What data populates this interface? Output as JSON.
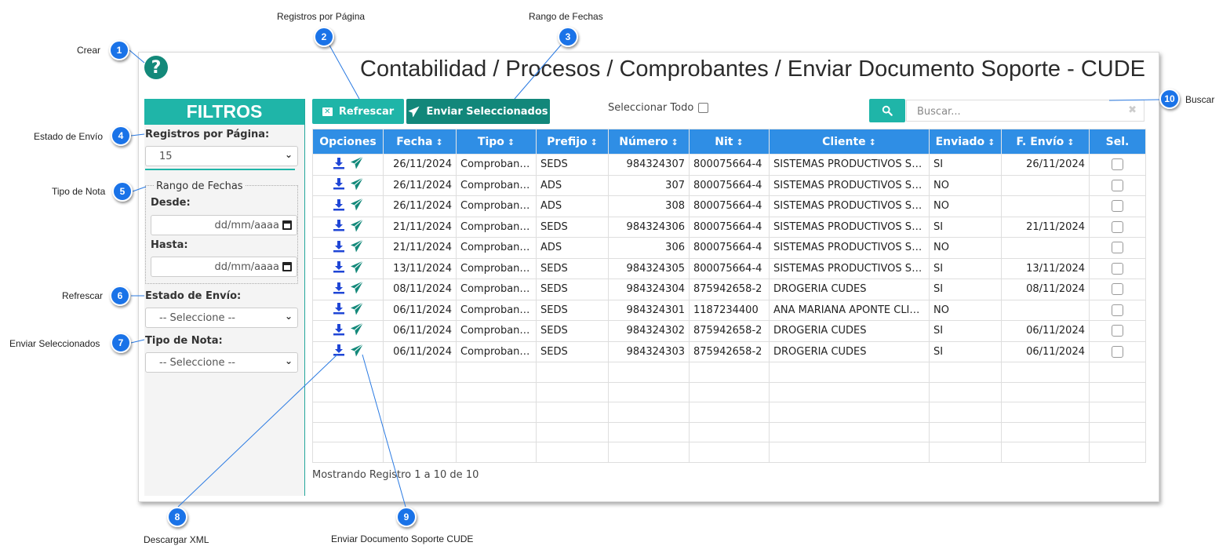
{
  "page": {
    "title": "Contabilidad / Procesos / Comprobantes / Enviar Documento Soporte - CUDE",
    "help_glyph": "?"
  },
  "sidebar": {
    "header": "FILTROS",
    "registros_label": "Registros por Página:",
    "registros_value": "15",
    "date_range_legend": "Rango de Fechas",
    "desde_label": "Desde:",
    "desde_placeholder": "dd/mm/aaaa",
    "hasta_label": "Hasta:",
    "hasta_placeholder": "dd/mm/aaaa",
    "estado_label": "Estado de Envío:",
    "estado_value": "-- Seleccione --",
    "tipo_label": "Tipo de Nota:",
    "tipo_value": "-- Seleccione --"
  },
  "toolbar": {
    "refresh_label": "Refrescar",
    "send_label": "Enviar Seleccionados",
    "select_all_label": "Seleccionar Todo",
    "search_placeholder": "Buscar..."
  },
  "table": {
    "columns": [
      "Opciones",
      "Fecha",
      "Tipo",
      "Prefijo",
      "Número",
      "Nit",
      "Cliente",
      "Enviado",
      "F. Envío",
      "Sel."
    ],
    "rows": [
      {
        "fecha": "26/11/2024",
        "tipo": "Comprobante...",
        "prefijo": "SEDS",
        "numero": "984324307",
        "nit": "800075664-4",
        "cliente": "SISTEMAS PRODUCTIVOS SAS",
        "enviado": "SI",
        "f_envio": "26/11/2024"
      },
      {
        "fecha": "26/11/2024",
        "tipo": "Comprobante...",
        "prefijo": "ADS",
        "numero": "307",
        "nit": "800075664-4",
        "cliente": "SISTEMAS PRODUCTIVOS SAS",
        "enviado": "NO",
        "f_envio": ""
      },
      {
        "fecha": "26/11/2024",
        "tipo": "Comprobante...",
        "prefijo": "ADS",
        "numero": "308",
        "nit": "800075664-4",
        "cliente": "SISTEMAS PRODUCTIVOS SAS",
        "enviado": "NO",
        "f_envio": ""
      },
      {
        "fecha": "21/11/2024",
        "tipo": "Comprobante...",
        "prefijo": "SEDS",
        "numero": "984324306",
        "nit": "800075664-4",
        "cliente": "SISTEMAS PRODUCTIVOS SAS",
        "enviado": "SI",
        "f_envio": "21/11/2024"
      },
      {
        "fecha": "21/11/2024",
        "tipo": "Comprobante...",
        "prefijo": "ADS",
        "numero": "306",
        "nit": "800075664-4",
        "cliente": "SISTEMAS PRODUCTIVOS SAS",
        "enviado": "NO",
        "f_envio": ""
      },
      {
        "fecha": "13/11/2024",
        "tipo": "Comprobante...",
        "prefijo": "SEDS",
        "numero": "984324305",
        "nit": "800075664-4",
        "cliente": "SISTEMAS PRODUCTIVOS SAS",
        "enviado": "SI",
        "f_envio": "13/11/2024"
      },
      {
        "fecha": "08/11/2024",
        "tipo": "Comprobante...",
        "prefijo": "SEDS",
        "numero": "984324304",
        "nit": "875942658-2",
        "cliente": "DROGERIA CUDES",
        "enviado": "SI",
        "f_envio": "08/11/2024"
      },
      {
        "fecha": "06/11/2024",
        "tipo": "Comprobante...",
        "prefijo": "SEDS",
        "numero": "984324301",
        "nit": "1187234400",
        "cliente": "ANA MARIANA APONTE CLIE...",
        "enviado": "NO",
        "f_envio": ""
      },
      {
        "fecha": "06/11/2024",
        "tipo": "Comprobante...",
        "prefijo": "SEDS",
        "numero": "984324302",
        "nit": "875942658-2",
        "cliente": "DROGERIA CUDES",
        "enviado": "SI",
        "f_envio": "06/11/2024"
      },
      {
        "fecha": "06/11/2024",
        "tipo": "Comprobante...",
        "prefijo": "SEDS",
        "numero": "984324303",
        "nit": "875942658-2",
        "cliente": "DROGERIA CUDES",
        "enviado": "SI",
        "f_envio": "06/11/2024"
      }
    ],
    "empty_rows": 5,
    "footer": "Mostrando Registro 1 a 10 de 10"
  },
  "callouts": [
    {
      "number": "1",
      "label": "Crear"
    },
    {
      "number": "2",
      "label": "Registros por Página"
    },
    {
      "number": "3",
      "label": "Rango de Fechas"
    },
    {
      "number": "4",
      "label": "Estado de Envío"
    },
    {
      "number": "5",
      "label": "Tipo de Nota"
    },
    {
      "number": "6",
      "label": "Refrescar"
    },
    {
      "number": "7",
      "label": "Enviar Seleccionados"
    },
    {
      "number": "8",
      "label": "Descargar XML"
    },
    {
      "number": "9",
      "label": "Enviar Documento Soporte CUDE"
    },
    {
      "number": "10",
      "label": "Buscar"
    }
  ],
  "colors": {
    "teal": "#1fb5a8",
    "dark_teal": "#12877a",
    "header_blue": "#2f8ee5",
    "callout_blue": "#1a73e8",
    "download_icon": "#1f46d6",
    "send_icon": "#13897a"
  },
  "icons": {
    "help": "question-circle-icon",
    "refresh": "close-square-icon",
    "send": "paper-plane-icon",
    "search": "search-icon",
    "download": "download-icon",
    "sort": "sort-icon",
    "calendar": "calendar-icon",
    "chevron": "chevron-down-icon"
  }
}
